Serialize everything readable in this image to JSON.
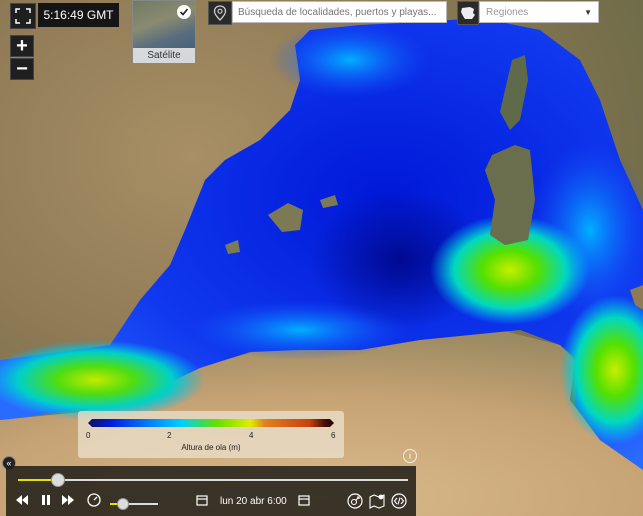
{
  "header": {
    "time": "5:16:49 GMT",
    "zoom_in": "+",
    "zoom_out": "−"
  },
  "layer": {
    "label": "Satélite"
  },
  "search": {
    "placeholder": "Búsqueda de localidades, puertos y playas..."
  },
  "regions": {
    "label": "Regiones"
  },
  "legend": {
    "title": "Altura de ola (m)",
    "ticks": [
      "0",
      "2",
      "4",
      "6"
    ],
    "range": [
      0,
      6
    ]
  },
  "timeline": {
    "date": "lun 20 abr 6:00",
    "progress": 0.1,
    "speed": 0.25
  },
  "colors": {
    "sea_deep": "#0010c8",
    "sea_mid": "#1e5bff",
    "sea_light": "#00c8ff",
    "wave_green": "#46e000",
    "wave_yellow": "#c8f000",
    "land": "#a58b62"
  }
}
